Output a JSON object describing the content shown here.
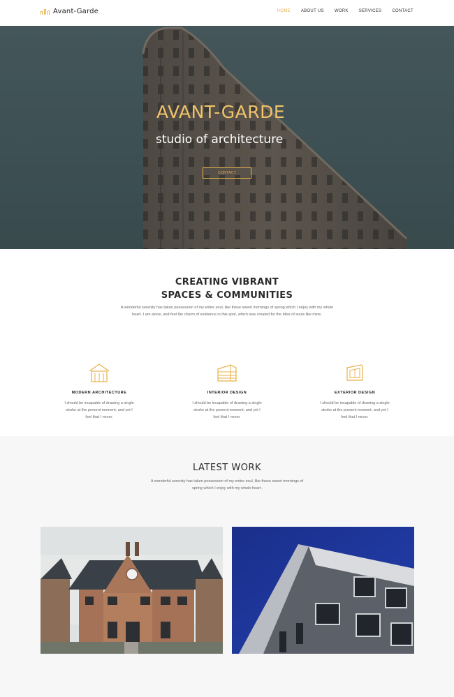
{
  "nav": {
    "brand": "Avant-Garde",
    "menu": [
      {
        "label": "HOME"
      },
      {
        "label": "ABOUT US"
      },
      {
        "label": "WORK"
      },
      {
        "label": "SERVICES"
      },
      {
        "label": "CONTACT"
      }
    ]
  },
  "hero": {
    "title": "AVANT-GARDE",
    "subtitle": "studio of architecture",
    "button": "CONTACT"
  },
  "intro": {
    "title_line1": "CREATING VIBRANT",
    "title_line2": "SPACES & COMMUNITIES",
    "description": "A wonderful serenity has taken possession of my entire soul, like these sweet mornings of spring which I enjoy with my whole heart. I am alone, and feel the charm of existence in this spot, which was created for the bliss of souls like mine."
  },
  "features": [
    {
      "icon": "house-icon",
      "title": "MODERN ARCHITECTURE",
      "text": "I should be incapable of drawing a single stroke at the present moment; and yet I feel that I never."
    },
    {
      "icon": "building-icon",
      "title": "INTERIOR DESIGN",
      "text": "I should be incapable of drawing a single stroke at the present moment; and yet I feel that I never."
    },
    {
      "icon": "blueprint-icon",
      "title": "EXTERIOR DESIGN",
      "text": "I should be incapable of drawing a single stroke at the present moment; and yet I feel that I never."
    }
  ],
  "work": {
    "title": "LATEST WORK",
    "description": "A wonderful serenity has taken possession of my entire soul, like these sweet mornings of spring which I enjoy with my whole heart."
  },
  "colors": {
    "accent": "#e8b04a",
    "hero_bg": "#4a5a5e",
    "section_alt": "#f7f7f8"
  }
}
